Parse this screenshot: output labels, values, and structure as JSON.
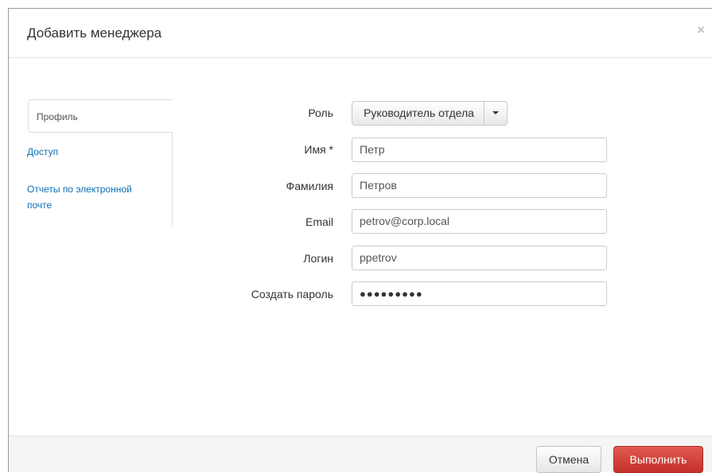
{
  "dialog": {
    "title": "Добавить менеджера",
    "close_glyph": "×"
  },
  "tabs": [
    {
      "label": "Профиль",
      "active": true
    },
    {
      "label": "Доступ",
      "active": false
    },
    {
      "label": "Отчеты по электронной почте",
      "active": false
    }
  ],
  "form": {
    "role": {
      "label": "Роль",
      "value": "Руководитель отдела"
    },
    "first_name": {
      "label": "Имя *",
      "value": "Петр"
    },
    "last_name": {
      "label": "Фамилия",
      "value": "Петров"
    },
    "email": {
      "label": "Email",
      "value": "petrov@corp.local"
    },
    "login": {
      "label": "Логин",
      "value": "ppetrov"
    },
    "password": {
      "label": "Создать пароль",
      "value": "●●●●●●●●●"
    }
  },
  "footer": {
    "cancel_label": "Отмена",
    "submit_label": "Выполнить"
  },
  "colors": {
    "accent": "#d9443b",
    "link": "#0a6fb6"
  }
}
